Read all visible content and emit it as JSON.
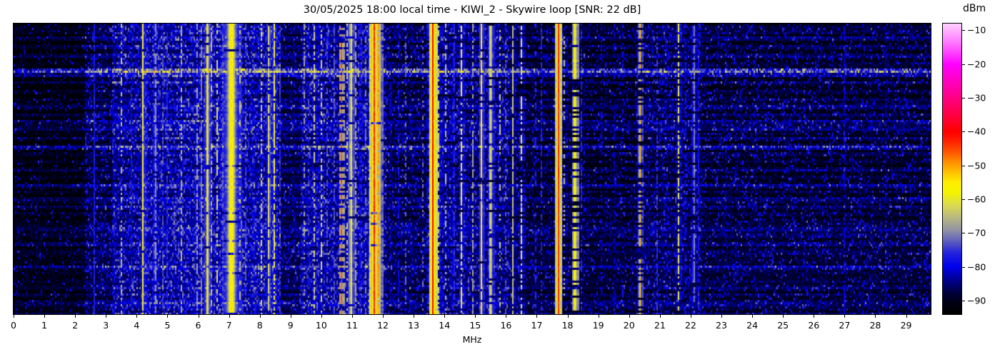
{
  "title": "30/05/2025 18:00 local time - KIWI_2 - Skywire loop [SNR: 22 dB]",
  "xaxis": {
    "label": "MHz",
    "ticks": [
      0,
      1,
      2,
      3,
      4,
      5,
      6,
      7,
      8,
      9,
      10,
      11,
      12,
      13,
      14,
      15,
      16,
      17,
      18,
      19,
      20,
      21,
      22,
      23,
      24,
      25,
      26,
      27,
      28,
      29
    ],
    "min": 0,
    "max": 29.8
  },
  "colorbar": {
    "label": "dBm",
    "ticks": [
      {
        "v": -10,
        "label": "−10"
      },
      {
        "v": -20,
        "label": "−20"
      },
      {
        "v": -30,
        "label": "−30"
      },
      {
        "v": -40,
        "label": "−40"
      },
      {
        "v": -50,
        "label": "−50"
      },
      {
        "v": -60,
        "label": "−60"
      },
      {
        "v": -70,
        "label": "−70"
      },
      {
        "v": -80,
        "label": "−80"
      },
      {
        "v": -90,
        "label": "−90"
      }
    ],
    "min": -94,
    "max": -8
  },
  "chart_data": {
    "type": "heatmap",
    "title": "30/05/2025 18:00 local time - KIWI_2 - Skywire loop [SNR: 22 dB]",
    "xlabel": "MHz",
    "ylabel": "",
    "y_axis_note": "vertical axis is time (waterfall), no tick labels shown",
    "colorbar_label": "dBm",
    "x_range_mhz": [
      0,
      29.8
    ],
    "level_range_dbm": [
      -94,
      -8
    ],
    "render_seed": 1337,
    "colormap_stops": [
      [
        -94,
        "#000000"
      ],
      [
        -91,
        "#000010"
      ],
      [
        -88,
        "#000038"
      ],
      [
        -84,
        "#000090"
      ],
      [
        -80,
        "#0000ee"
      ],
      [
        -76,
        "#2222dd"
      ],
      [
        -72,
        "#6666bb"
      ],
      [
        -69,
        "#9494a4"
      ],
      [
        -66,
        "#b2b288"
      ],
      [
        -62,
        "#d8d855"
      ],
      [
        -58,
        "#f5f500"
      ],
      [
        -55,
        "#ffee00"
      ],
      [
        -52,
        "#ffc000"
      ],
      [
        -49,
        "#ff9000"
      ],
      [
        -46,
        "#ff5500"
      ],
      [
        -42,
        "#ff1500"
      ],
      [
        -40,
        "#ff0000"
      ],
      [
        -34,
        "#ff0050"
      ],
      [
        -27,
        "#ff00aa"
      ],
      [
        -20,
        "#ff00ff"
      ],
      [
        -14,
        "#ff70ff"
      ],
      [
        -8,
        "#ffd0ff"
      ]
    ],
    "background_regions_format": [
      "f_start_mhz",
      "f_end_mhz",
      "base_level_dbm",
      "speckle_prob"
    ],
    "background_regions": [
      [
        0.0,
        2.3,
        -93.5,
        0.07
      ],
      [
        2.3,
        3.2,
        -90.5,
        0.18
      ],
      [
        3.2,
        4.2,
        -88.0,
        0.3
      ],
      [
        4.2,
        8.7,
        -87.0,
        0.33
      ],
      [
        8.7,
        9.35,
        -90.0,
        0.15
      ],
      [
        9.35,
        12.1,
        -87.5,
        0.28
      ],
      [
        12.1,
        13.5,
        -90.5,
        0.18
      ],
      [
        13.5,
        16.1,
        -89.0,
        0.25
      ],
      [
        16.1,
        16.6,
        -90.0,
        0.15
      ],
      [
        16.6,
        18.6,
        -91.5,
        0.13
      ],
      [
        18.6,
        20.2,
        -92.0,
        0.12
      ],
      [
        20.2,
        22.35,
        -90.5,
        0.2
      ],
      [
        22.35,
        29.8,
        -91.5,
        0.17
      ]
    ],
    "signals_format": [
      "center_mhz",
      "width_mhz",
      "peak_level_dbm",
      "duty"
    ],
    "signals": [
      [
        0.05,
        0.03,
        -80,
        0.5
      ],
      [
        2.62,
        0.03,
        -77,
        0.95
      ],
      [
        3.28,
        0.04,
        -80,
        0.6
      ],
      [
        3.5,
        0.03,
        -64,
        0.45
      ],
      [
        3.62,
        0.03,
        -78,
        0.5
      ],
      [
        3.83,
        0.05,
        -79,
        0.6
      ],
      [
        4.2,
        0.05,
        -57,
        0.95
      ],
      [
        4.33,
        0.03,
        -76,
        0.6
      ],
      [
        4.6,
        0.04,
        -60,
        0.7
      ],
      [
        4.85,
        0.04,
        -74,
        0.5
      ],
      [
        5.0,
        0.05,
        -73,
        0.6
      ],
      [
        5.2,
        0.04,
        -76,
        0.5
      ],
      [
        5.45,
        0.04,
        -65,
        0.45
      ],
      [
        5.75,
        0.04,
        -74,
        0.5
      ],
      [
        5.95,
        0.05,
        -62,
        0.55
      ],
      [
        6.1,
        0.04,
        -70,
        0.6
      ],
      [
        6.3,
        0.08,
        -55,
        0.9
      ],
      [
        6.42,
        0.03,
        -62,
        0.4
      ],
      [
        6.62,
        0.04,
        -60,
        0.5
      ],
      [
        6.78,
        0.04,
        -62,
        0.45
      ],
      [
        7.08,
        0.25,
        -55,
        0.95
      ],
      [
        7.06,
        0.08,
        -50,
        0.45
      ],
      [
        7.35,
        0.04,
        -62,
        0.4
      ],
      [
        7.55,
        0.04,
        -72,
        0.5
      ],
      [
        7.8,
        0.04,
        -67,
        0.4
      ],
      [
        8.05,
        0.04,
        -62,
        0.4
      ],
      [
        8.3,
        0.06,
        -57,
        0.85
      ],
      [
        8.47,
        0.05,
        -58,
        0.7
      ],
      [
        8.65,
        0.04,
        -73,
        0.5
      ],
      [
        9.45,
        0.04,
        -67,
        0.45
      ],
      [
        9.6,
        0.03,
        -70,
        0.4
      ],
      [
        9.78,
        0.04,
        -60,
        0.55
      ],
      [
        10.0,
        0.05,
        -62,
        0.5
      ],
      [
        10.2,
        0.04,
        -70,
        0.5
      ],
      [
        10.42,
        0.04,
        -73,
        0.5
      ],
      [
        10.65,
        0.05,
        -46,
        0.5
      ],
      [
        10.85,
        0.03,
        -60,
        0.35
      ],
      [
        10.96,
        0.05,
        -52,
        0.9
      ],
      [
        11.12,
        0.04,
        -67,
        0.55
      ],
      [
        11.28,
        0.04,
        -66,
        0.6
      ],
      [
        11.45,
        0.03,
        -69,
        0.5
      ],
      [
        11.58,
        0.04,
        -56,
        0.8
      ],
      [
        11.72,
        0.12,
        -43,
        0.95
      ],
      [
        11.86,
        0.07,
        -50,
        0.85
      ],
      [
        11.97,
        0.05,
        -66,
        0.8
      ],
      [
        12.25,
        0.03,
        -72,
        0.4
      ],
      [
        12.5,
        0.03,
        -76,
        0.4
      ],
      [
        12.75,
        0.03,
        -70,
        0.4
      ],
      [
        12.95,
        0.03,
        -74,
        0.4
      ],
      [
        13.3,
        0.03,
        -71,
        0.3
      ],
      [
        13.52,
        0.03,
        -58,
        0.5
      ],
      [
        13.63,
        0.08,
        -40,
        1.0
      ],
      [
        13.82,
        0.04,
        -60,
        0.5
      ],
      [
        14.05,
        0.04,
        -62,
        0.45
      ],
      [
        14.3,
        0.04,
        -66,
        0.7
      ],
      [
        14.55,
        0.05,
        -58,
        0.7
      ],
      [
        14.93,
        0.04,
        -66,
        0.55
      ],
      [
        15.2,
        0.06,
        -55,
        0.9
      ],
      [
        15.5,
        0.07,
        -55,
        0.85
      ],
      [
        15.8,
        0.04,
        -62,
        0.4
      ],
      [
        16.0,
        0.03,
        -70,
        0.4
      ],
      [
        16.22,
        0.05,
        -64,
        0.85
      ],
      [
        16.5,
        0.04,
        -58,
        0.6
      ],
      [
        16.95,
        0.03,
        -69,
        0.45
      ],
      [
        17.15,
        0.03,
        -76,
        0.5
      ],
      [
        17.7,
        0.06,
        -42,
        1.0
      ],
      [
        17.88,
        0.03,
        -60,
        0.3
      ],
      [
        18.24,
        0.06,
        -48,
        0.7
      ],
      [
        18.45,
        0.03,
        -76,
        0.5
      ],
      [
        19.1,
        0.03,
        -80,
        0.4
      ],
      [
        19.5,
        0.03,
        -73,
        0.4
      ],
      [
        19.78,
        0.03,
        -71,
        0.35
      ],
      [
        20.35,
        0.05,
        -52,
        0.6
      ],
      [
        20.65,
        0.03,
        -76,
        0.4
      ],
      [
        20.92,
        0.05,
        -73,
        0.6
      ],
      [
        21.25,
        0.03,
        -78,
        0.5
      ],
      [
        21.6,
        0.03,
        -58,
        0.6
      ],
      [
        21.82,
        0.03,
        -69,
        0.4
      ],
      [
        22.1,
        0.05,
        -62,
        0.7
      ],
      [
        22.27,
        0.03,
        -73,
        0.7
      ],
      [
        23.15,
        0.03,
        -80,
        0.5
      ],
      [
        24.05,
        0.03,
        -80,
        0.5
      ],
      [
        25.35,
        0.03,
        -82,
        0.4
      ],
      [
        27.0,
        0.03,
        -79,
        0.6
      ],
      [
        28.35,
        0.03,
        -79,
        0.5
      ]
    ],
    "horizontal_bands_format": [
      "y_fraction_from_top",
      "boost_db"
    ],
    "horizontal_bands": [
      [
        0.02,
        4
      ],
      [
        0.05,
        5
      ],
      [
        0.08,
        4
      ],
      [
        0.11,
        6
      ],
      [
        0.135,
        4
      ],
      [
        0.158,
        17
      ],
      [
        0.172,
        7
      ],
      [
        0.2,
        4
      ],
      [
        0.23,
        5
      ],
      [
        0.26,
        4
      ],
      [
        0.285,
        6
      ],
      [
        0.31,
        4
      ],
      [
        0.335,
        5
      ],
      [
        0.36,
        7
      ],
      [
        0.39,
        4
      ],
      [
        0.42,
        9
      ],
      [
        0.445,
        5
      ],
      [
        0.47,
        4
      ],
      [
        0.5,
        6
      ],
      [
        0.525,
        4
      ],
      [
        0.55,
        5
      ],
      [
        0.575,
        4
      ],
      [
        0.6,
        6
      ],
      [
        0.625,
        4
      ],
      [
        0.65,
        5
      ],
      [
        0.675,
        4
      ],
      [
        0.7,
        6
      ],
      [
        0.73,
        4
      ],
      [
        0.755,
        7
      ],
      [
        0.78,
        5
      ],
      [
        0.805,
        4
      ],
      [
        0.83,
        6
      ],
      [
        0.855,
        4
      ],
      [
        0.88,
        5
      ],
      [
        0.905,
        6
      ],
      [
        0.93,
        4
      ],
      [
        0.95,
        5
      ],
      [
        0.97,
        4
      ],
      [
        0.995,
        6
      ]
    ]
  }
}
